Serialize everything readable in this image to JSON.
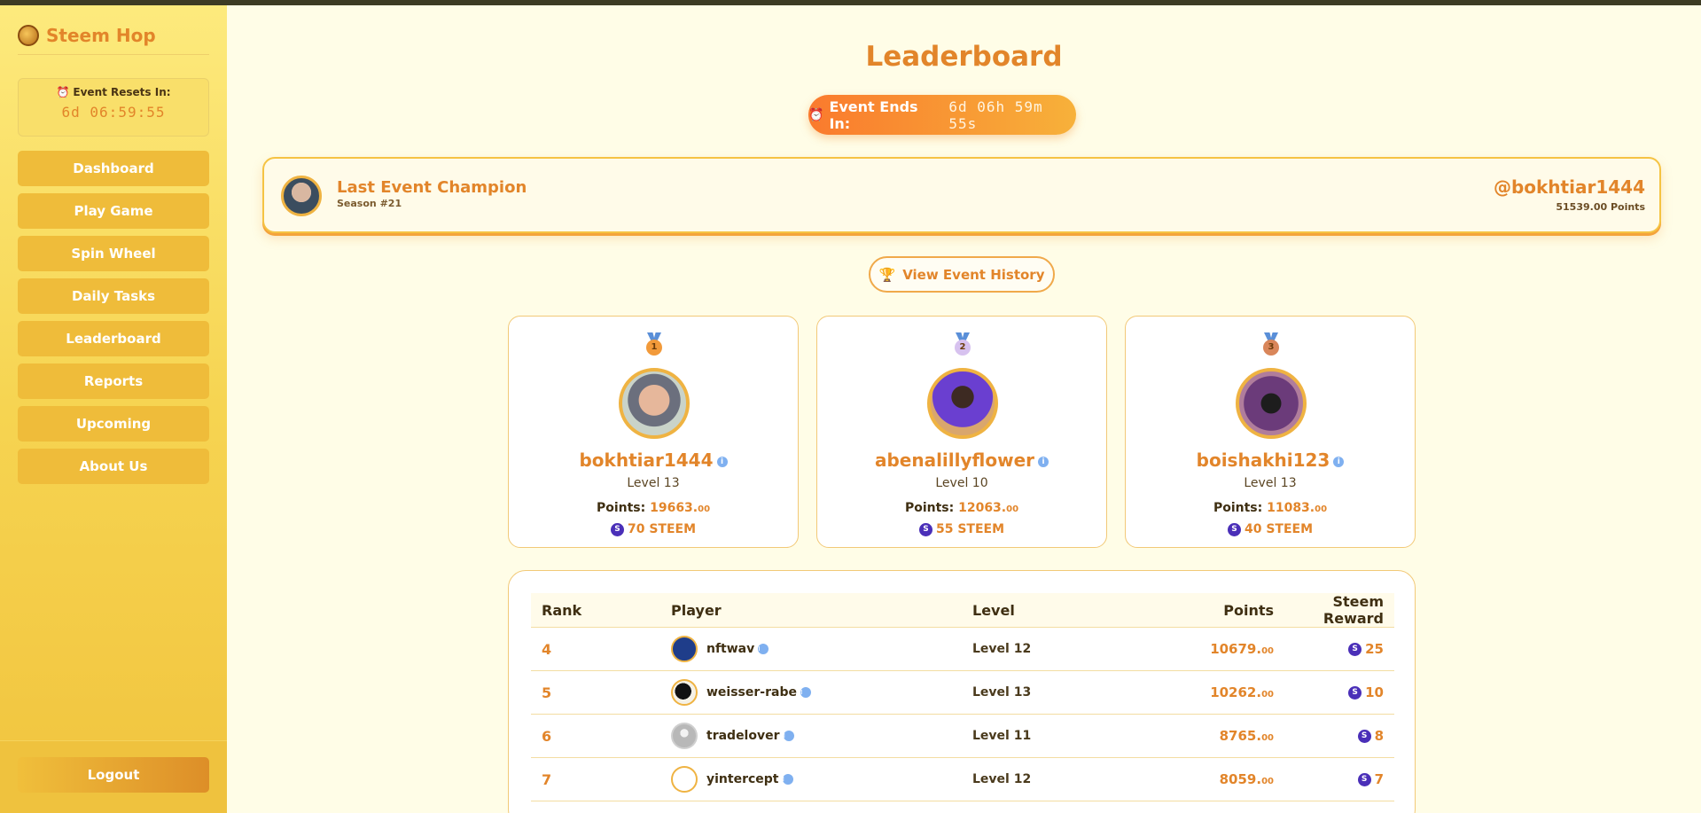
{
  "app": {
    "name": "Steem Hop"
  },
  "sidebar": {
    "reset_label": "Event Resets In:",
    "reset_timer": "6d 06:59:55",
    "items": [
      {
        "label": "Dashboard"
      },
      {
        "label": "Play Game"
      },
      {
        "label": "Spin Wheel"
      },
      {
        "label": "Daily Tasks"
      },
      {
        "label": "Leaderboard"
      },
      {
        "label": "Reports"
      },
      {
        "label": "Upcoming"
      },
      {
        "label": "About Us"
      }
    ],
    "logout_label": "Logout"
  },
  "main": {
    "title": "Leaderboard",
    "event_ends_label": "Event Ends In:",
    "event_ends_timer": "6d 06h 59m 55s",
    "champion": {
      "title": "Last Event Champion",
      "season": "Season #21",
      "username": "@bokhtiar1444",
      "points": "51539.00 Points"
    },
    "history_button": "View Event History",
    "podium": [
      {
        "rank": "1",
        "name": "bokhtiar1444",
        "level": "Level 13",
        "points_label": "Points:",
        "points": "19663.",
        "points_dec": "00",
        "reward": "70 STEEM",
        "medal_color": "#f29a3a"
      },
      {
        "rank": "2",
        "name": "abenalillyflower",
        "level": "Level 10",
        "points_label": "Points:",
        "points": "12063.",
        "points_dec": "00",
        "reward": "55 STEEM",
        "medal_color": "#d7c2ef"
      },
      {
        "rank": "3",
        "name": "boishakhi123",
        "level": "Level 13",
        "points_label": "Points:",
        "points": "11083.",
        "points_dec": "00",
        "reward": "40 STEEM",
        "medal_color": "#d9865a"
      }
    ],
    "table": {
      "headers": {
        "rank": "Rank",
        "player": "Player",
        "level": "Level",
        "points": "Points",
        "reward": "Steem Reward"
      },
      "rows": [
        {
          "rank": "4",
          "player": "nftwav",
          "level": "Level 12",
          "points": "10679.",
          "points_dec": "00",
          "reward": "25"
        },
        {
          "rank": "5",
          "player": "weisser-rabe",
          "level": "Level 13",
          "points": "10262.",
          "points_dec": "00",
          "reward": "10"
        },
        {
          "rank": "6",
          "player": "tradelover",
          "level": "Level 11",
          "points": "8765.",
          "points_dec": "00",
          "reward": "8"
        },
        {
          "rank": "7",
          "player": "yintercept",
          "level": "Level 12",
          "points": "8059.",
          "points_dec": "00",
          "reward": "7"
        }
      ]
    }
  }
}
